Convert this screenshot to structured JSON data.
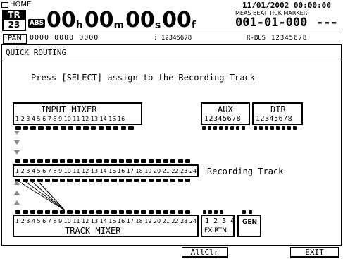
{
  "header": {
    "home_label": "HOME",
    "track_badge_top": "TR",
    "track_badge_num": "23",
    "abs_badge": "ABS",
    "time": {
      "h": "00",
      "m": "00",
      "s": "00",
      "f": "00"
    },
    "time_units": {
      "h": "h",
      "m": "m",
      "s": "s",
      "f": "f"
    },
    "date_time": "11/01/2002 00:00:00",
    "meas_beat_tick_marker_label": "MEAS BEAT TICK MARKER",
    "meas_value": "001-01-000",
    "marker_value": "---",
    "pan_label": "PAN",
    "pan_circles": "0000 0000 0000",
    "track_numbers": ": 12345678",
    "rbus_label": "R-BUS",
    "rbus_numbers": "12345678"
  },
  "screen": {
    "title": "QUICK ROUTING",
    "instruction": "Press [SELECT] assign to the Recording Track",
    "input_mixer": {
      "label": "INPUT MIXER",
      "channels": "1 2 3 4 5 6 7 8 9 10 11 12 13 14 15 16"
    },
    "aux": {
      "label": "AUX",
      "channels": "12345678"
    },
    "dir": {
      "label": "DIR",
      "channels": "12345678"
    },
    "recording_track": {
      "channels": "1 2 3 4 5 6 7 8 9 10 11 12 13 14 15 16 17 18 19 20 21 22 23 24",
      "label": "Recording Track"
    },
    "track_mixer": {
      "label": "TRACK MIXER",
      "channels": "1 2 3 4 5 6 7 8 9 10 11 12 13 14 15 16 17 18 19 20 21 22 23 24"
    },
    "fx_rtn": {
      "channels": "1 2 3 4",
      "label": "FX RTN"
    },
    "gen": {
      "label": "GEN"
    }
  },
  "footer": {
    "allclr_label": "AllClr",
    "exit_label": "EXIT"
  }
}
